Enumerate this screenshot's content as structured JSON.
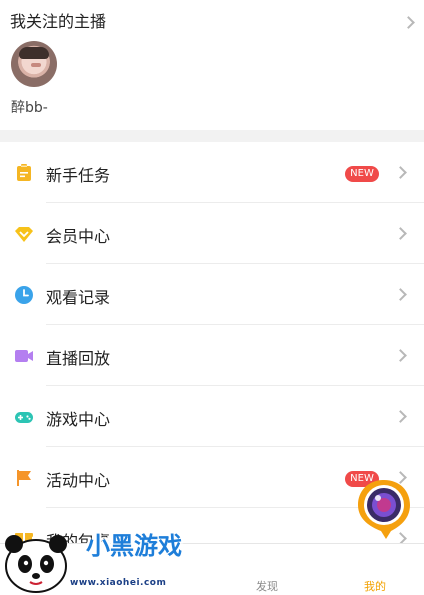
{
  "follow": {
    "title": "我关注的主播",
    "streamer_name": "醉bb-"
  },
  "menu": {
    "items": [
      {
        "label": "新手任务",
        "icon": "task-icon",
        "badge": "NEW",
        "color": "#f5b623"
      },
      {
        "label": "会员中心",
        "icon": "diamond-icon",
        "color": "#f7c21a"
      },
      {
        "label": "观看记录",
        "icon": "clock-icon",
        "color": "#3aa3ea"
      },
      {
        "label": "直播回放",
        "icon": "video-camera-icon",
        "color": "#b47ff0"
      },
      {
        "label": "游戏中心",
        "icon": "gamepad-icon",
        "color": "#2cc4b4"
      },
      {
        "label": "活动中心",
        "icon": "flag-icon",
        "badge": "NEW",
        "color": "#f5952a"
      },
      {
        "label": "我的包裹",
        "icon": "package-icon",
        "color": "#f5b623"
      }
    ]
  },
  "tabbar": {
    "tabs": [
      {
        "label": "发现"
      },
      {
        "label": "我的",
        "active": true
      }
    ],
    "active_color": "#f2a100"
  },
  "watermark": {
    "title": "小黑游戏",
    "url": "www.xiaohei.com"
  }
}
